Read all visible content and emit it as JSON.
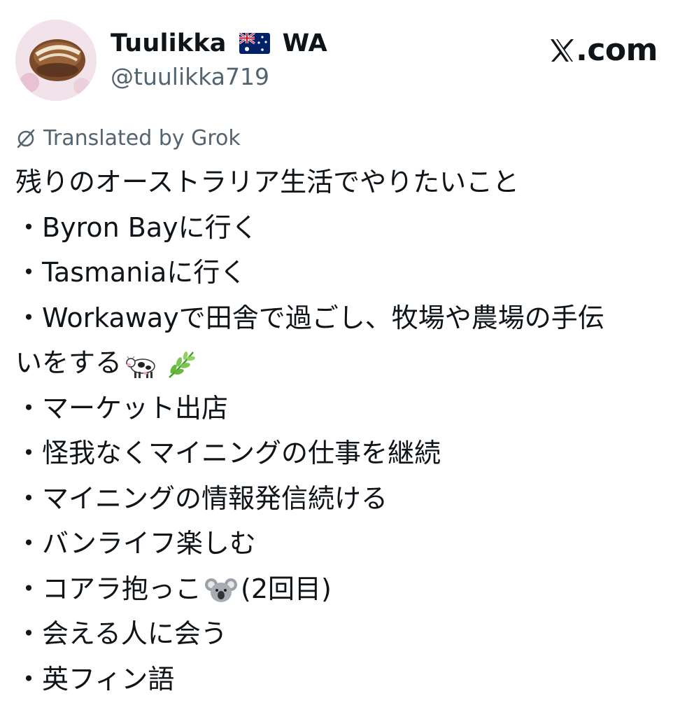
{
  "author": {
    "display_name": "Tuulikka",
    "region": "WA",
    "handle": "@tuulikka719",
    "flag_icon": "australia-flag"
  },
  "brand": {
    "text": ".com",
    "icon": "x-logo"
  },
  "translation": {
    "label": "Translated by Grok",
    "icon": "grok-icon"
  },
  "post": {
    "lines": [
      "残りのオーストラリア生活でやりたいこと",
      "・Byron Bayに行く",
      "・Tasmaniaに行く",
      "・Workawayで田舎で過ごし、牧場や農場の手伝",
      "いをする",
      "・マーケット出店",
      "・怪我なくマイニングの仕事を継続",
      "・マイニングの情報発信続ける",
      "・バンライフ楽しむ",
      "・コアラ抱っこ",
      "・会える人に会う",
      "・英フィン語"
    ],
    "koala_suffix": "(2回目)",
    "emojis": [
      "cow-emoji",
      "herb-emoji",
      "koala-emoji"
    ]
  },
  "colors": {
    "text": "#0f1419",
    "secondary": "#536471",
    "background": "#ffffff"
  }
}
